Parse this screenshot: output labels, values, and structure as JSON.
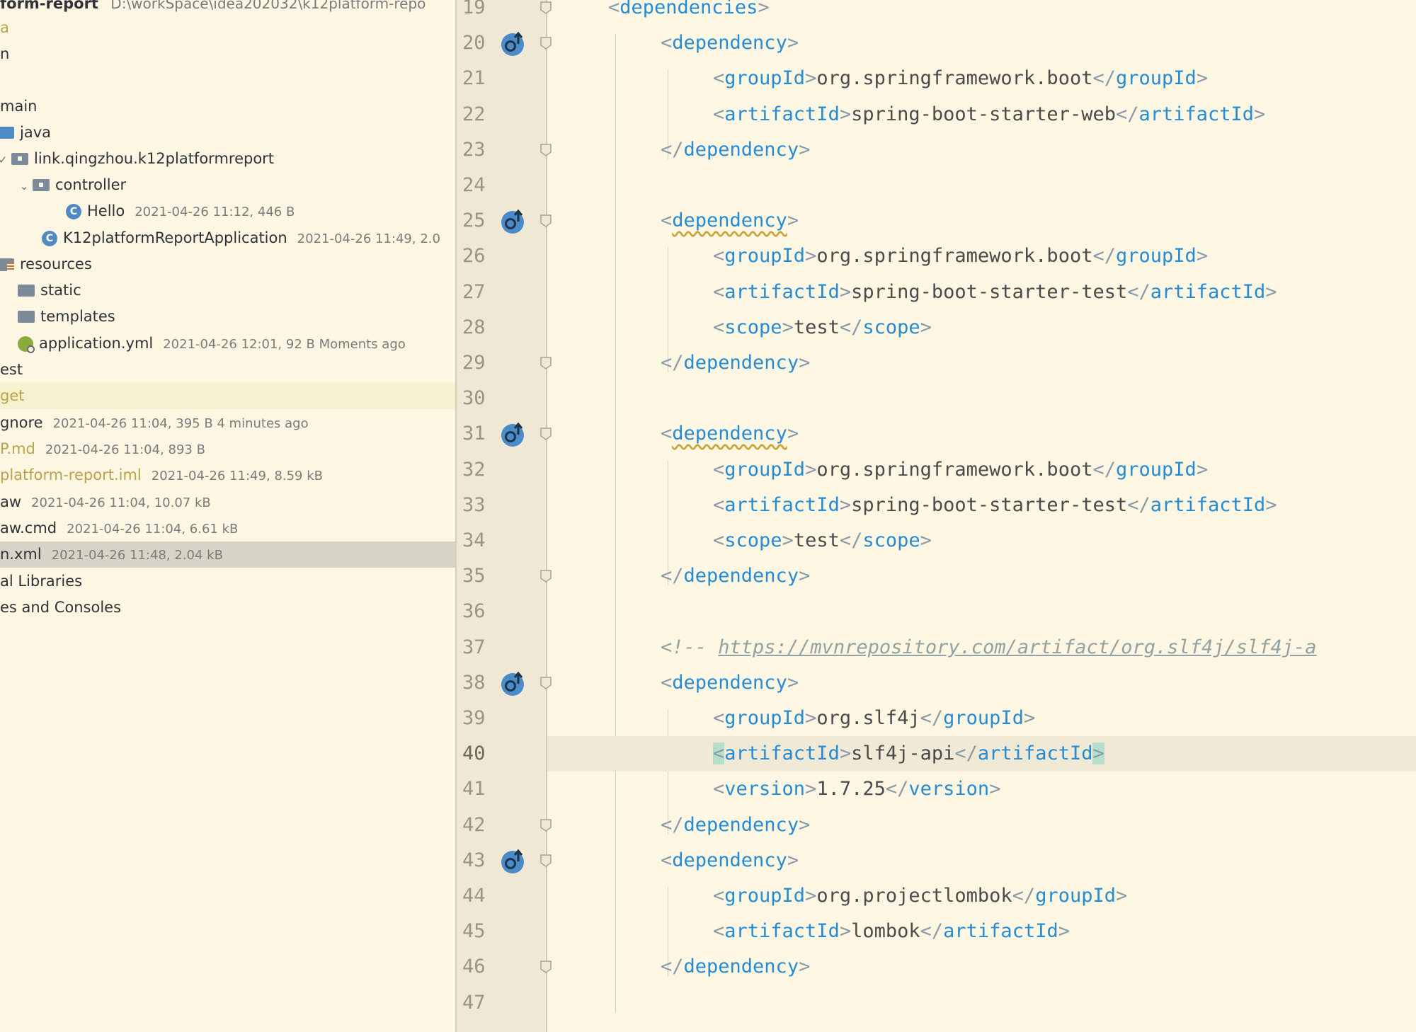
{
  "project": {
    "root_label": "form-report",
    "root_path": "D:\\workSpace\\idea202032\\k12platform-repo",
    "items": [
      {
        "label": "a",
        "meta": ""
      },
      {
        "label": "n",
        "meta": ""
      },
      {
        "label": "main",
        "meta": ""
      },
      {
        "label": "java",
        "meta": ""
      },
      {
        "label": "link.qingzhou.k12platformreport",
        "meta": ""
      },
      {
        "label": "controller",
        "meta": ""
      },
      {
        "label": "Hello",
        "meta": "2021-04-26 11:12, 446 B"
      },
      {
        "label": "K12platformReportApplication",
        "meta": "2021-04-26 11:49, 2.0"
      },
      {
        "label": "resources",
        "meta": ""
      },
      {
        "label": "static",
        "meta": ""
      },
      {
        "label": "templates",
        "meta": ""
      },
      {
        "label": "application.yml",
        "meta": "2021-04-26 12:01, 92 B Moments ago"
      },
      {
        "label": "est",
        "meta": ""
      },
      {
        "label": "get",
        "meta": ""
      },
      {
        "label": "gnore",
        "meta": "2021-04-26 11:04, 395 B 4 minutes ago"
      },
      {
        "label": "P.md",
        "meta": "2021-04-26 11:04, 893 B"
      },
      {
        "label": "platform-report.iml",
        "meta": "2021-04-26 11:49, 8.59 kB"
      },
      {
        "label": "aw",
        "meta": "2021-04-26 11:04, 10.07 kB"
      },
      {
        "label": "aw.cmd",
        "meta": "2021-04-26 11:04, 6.61 kB"
      },
      {
        "label": "n.xml",
        "meta": "2021-04-26 11:48, 2.04 kB"
      },
      {
        "label": "al Libraries",
        "meta": ""
      },
      {
        "label": "es and Consoles",
        "meta": ""
      }
    ]
  },
  "gutter": {
    "line_numbers": [
      "19",
      "20",
      "21",
      "22",
      "23",
      "24",
      "25",
      "26",
      "27",
      "28",
      "29",
      "30",
      "31",
      "32",
      "33",
      "34",
      "35",
      "36",
      "37",
      "38",
      "39",
      "40",
      "41",
      "42",
      "43",
      "44",
      "45",
      "46",
      "47"
    ],
    "current_line": "40",
    "override_icon": "override-up-arrow-icon",
    "fold_icon": "fold-marker-icon"
  },
  "editor": {
    "lines": [
      {
        "open": "<",
        "tag": "dependencies",
        "close": ">",
        "text": "",
        "end": ""
      },
      {
        "open": "<",
        "tag": "dependency",
        "close": ">",
        "text": "",
        "end": ""
      },
      {
        "open": "<",
        "tag": "groupId",
        "close": ">",
        "text": "org.springframework.boot",
        "end": "groupId"
      },
      {
        "open": "<",
        "tag": "artifactId",
        "close": ">",
        "text": "spring-boot-starter-web",
        "end": "artifactId"
      },
      {
        "open": "</",
        "tag": "dependency",
        "close": ">",
        "text": "",
        "end": ""
      },
      {
        "open": "",
        "tag": "",
        "close": "",
        "text": "",
        "end": ""
      },
      {
        "open": "<",
        "tag": "dependency",
        "close": ">",
        "text": "",
        "end": ""
      },
      {
        "open": "<",
        "tag": "groupId",
        "close": ">",
        "text": "org.springframework.boot",
        "end": "groupId"
      },
      {
        "open": "<",
        "tag": "artifactId",
        "close": ">",
        "text": "spring-boot-starter-test",
        "end": "artifactId"
      },
      {
        "open": "<",
        "tag": "scope",
        "close": ">",
        "text": "test",
        "end": "scope"
      },
      {
        "open": "</",
        "tag": "dependency",
        "close": ">",
        "text": "",
        "end": ""
      },
      {
        "open": "",
        "tag": "",
        "close": "",
        "text": "",
        "end": ""
      },
      {
        "open": "<",
        "tag": "dependency",
        "close": ">",
        "text": "",
        "end": ""
      },
      {
        "open": "<",
        "tag": "groupId",
        "close": ">",
        "text": "org.springframework.boot",
        "end": "groupId"
      },
      {
        "open": "<",
        "tag": "artifactId",
        "close": ">",
        "text": "spring-boot-starter-test",
        "end": "artifactId"
      },
      {
        "open": "<",
        "tag": "scope",
        "close": ">",
        "text": "test",
        "end": "scope"
      },
      {
        "open": "</",
        "tag": "dependency",
        "close": ">",
        "text": "",
        "end": ""
      },
      {
        "open": "",
        "tag": "",
        "close": "",
        "text": "",
        "end": ""
      },
      {
        "comment_prefix": "<!-- ",
        "comment_link": "https://mvnrepository.com/artifact/org.slf4j/slf4j-a"
      },
      {
        "open": "<",
        "tag": "dependency",
        "close": ">",
        "text": "",
        "end": ""
      },
      {
        "open": "<",
        "tag": "groupId",
        "close": ">",
        "text": "org.slf4j",
        "end": "groupId"
      },
      {
        "open": "<",
        "tag": "artifactId",
        "close": ">",
        "text": "slf4j-api",
        "end": "artifactId"
      },
      {
        "open": "<",
        "tag": "version",
        "close": ">",
        "text": "1.7.25",
        "end": "version"
      },
      {
        "open": "</",
        "tag": "dependency",
        "close": ">",
        "text": "",
        "end": ""
      },
      {
        "open": "<",
        "tag": "dependency",
        "close": ">",
        "text": "",
        "end": ""
      },
      {
        "open": "<",
        "tag": "groupId",
        "close": ">",
        "text": "org.projectlombok",
        "end": "groupId"
      },
      {
        "open": "<",
        "tag": "artifactId",
        "close": ">",
        "text": "lombok",
        "end": "artifactId"
      },
      {
        "open": "</",
        "tag": "dependency",
        "close": ">",
        "text": "",
        "end": ""
      },
      {
        "open": "",
        "tag": "",
        "close": "",
        "text": "",
        "end": ""
      }
    ]
  }
}
